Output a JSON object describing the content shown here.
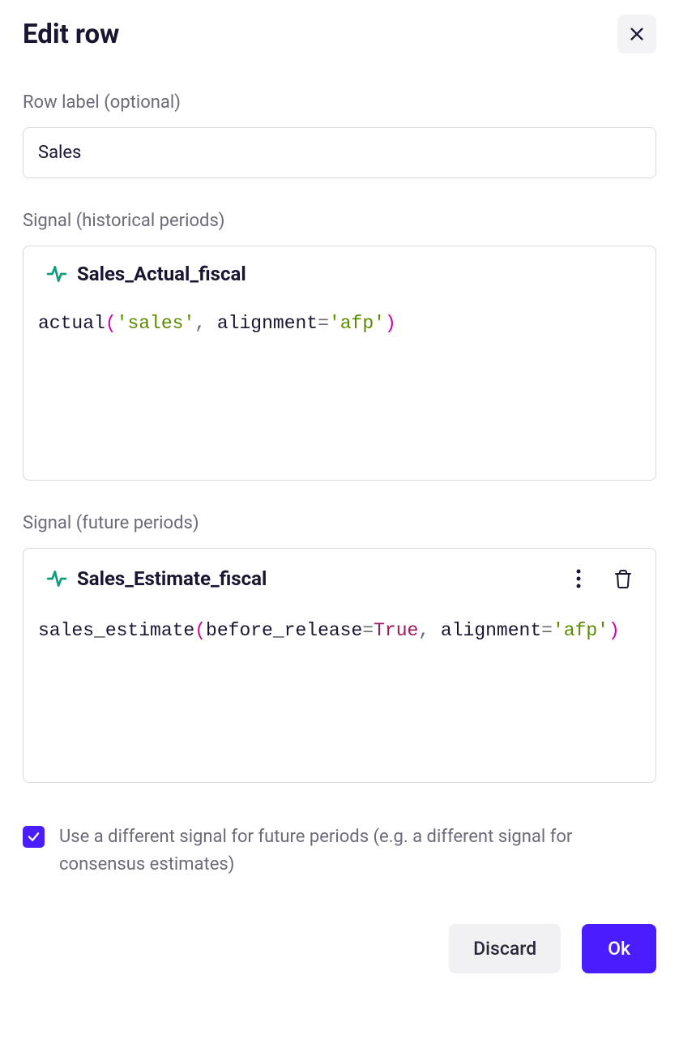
{
  "title": "Edit row",
  "rowLabel": {
    "label": "Row label (optional)",
    "value": "Sales"
  },
  "historical": {
    "label": "Signal (historical periods)",
    "name": "Sales_Actual_fiscal",
    "code": {
      "fn": "actual",
      "arg_str": "'sales'",
      "kwarg_key": "alignment",
      "kwarg_val": "'afp'"
    }
  },
  "future": {
    "label": "Signal (future periods)",
    "name": "Sales_Estimate_fiscal",
    "code": {
      "fn": "sales_estimate",
      "kwarg1_key": "before_release",
      "kwarg1_val": "True",
      "kwarg2_key": "alignment",
      "kwarg2_val": "'afp'"
    }
  },
  "checkbox": {
    "checked": true,
    "label": "Use a different signal for future periods (e.g. a different signal for consensus estimates)"
  },
  "buttons": {
    "discard": "Discard",
    "ok": "Ok"
  }
}
